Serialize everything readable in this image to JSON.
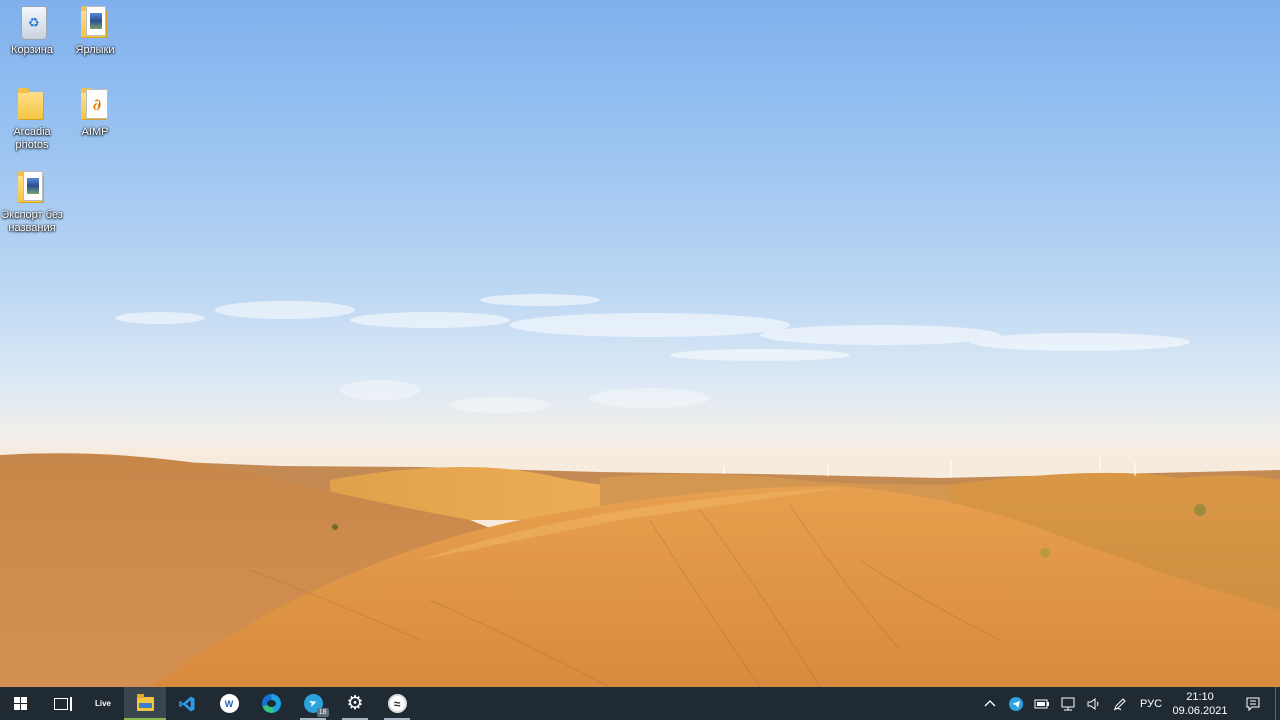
{
  "desktop": {
    "icons": [
      {
        "label": "Корзина",
        "icon": "recycle-bin-icon"
      },
      {
        "label": "Ярлыки",
        "icon": "folder-icon"
      },
      {
        "label": "Arcadia photos",
        "icon": "folder-icon"
      },
      {
        "label": "AIMP",
        "icon": "aimp-folder-icon"
      },
      {
        "label": "Экспорт без названия",
        "icon": "folder-image-icon"
      }
    ]
  },
  "taskbar": {
    "live_label": "Live",
    "word_glyph": "W",
    "telegram_badge": "18",
    "tray": {
      "language": "РУС",
      "time": "21:10",
      "date": "09.06.2021"
    }
  },
  "colors": {
    "taskbar_bg": "#1f2a33",
    "active_indicator": "#8ab64f",
    "sky_top": "#7fb0ee",
    "sand": "#d28a3c"
  }
}
